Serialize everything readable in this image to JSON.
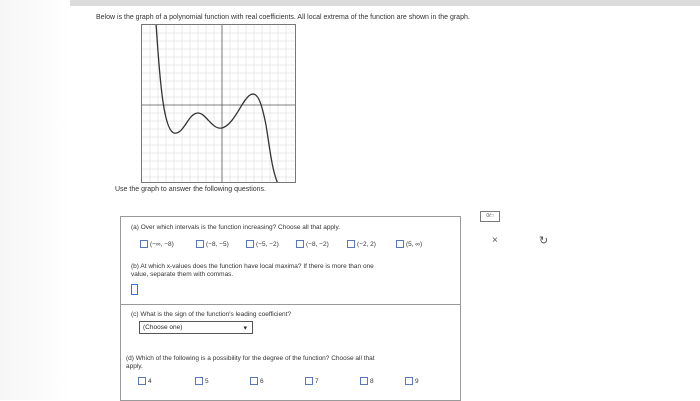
{
  "intro": "Below is the graph of a polynomial function with real coefficients. All local extrema of the function are shown in the graph.",
  "instructions": "Use the graph to answer the following questions.",
  "qa": {
    "question": "(a) Over which intervals is the function increasing? Choose all that apply.",
    "options": [
      "(−∞, −8)",
      "(−8, −5)",
      "(−5, −2)",
      "(−8, −2)",
      "(−2, 2)",
      "(5, ∞)"
    ]
  },
  "qb": {
    "question_line1": "(b) At which x-values does the function have local maxima? If there is more than one",
    "question_line2": "value, separate them with commas."
  },
  "qc": {
    "question": "(c) What is the sign of the function's leading coefficient?",
    "select_value": "(Choose one)"
  },
  "qd": {
    "question_line1": "(d) Which of the following is a possibility for the degree of the function? Choose all that",
    "question_line2": "apply.",
    "options": [
      "4",
      "5",
      "6",
      "7",
      "8",
      "9"
    ]
  },
  "side": {
    "fraction_icon": "0/□",
    "clear_icon": "×",
    "undo_icon": "↻"
  },
  "colors": {
    "curve": "#333333",
    "grid": "#d0d0d0",
    "checkbox_border": "#5a78b8",
    "answer_border": "#3b6fd8"
  }
}
